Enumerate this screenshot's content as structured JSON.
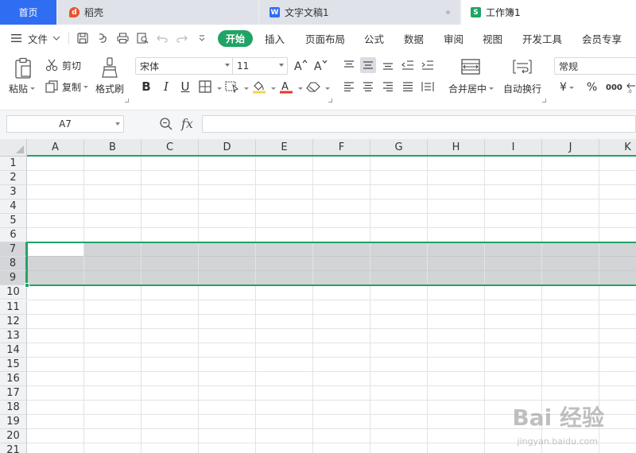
{
  "tabs": [
    {
      "label": "首页"
    },
    {
      "label": "稻壳"
    },
    {
      "label": "文字文稿1"
    },
    {
      "label": "工作簿1"
    }
  ],
  "menu": {
    "file": "文件",
    "start": "开始",
    "items": [
      "插入",
      "页面布局",
      "公式",
      "数据",
      "审阅",
      "视图",
      "开发工具",
      "会员专享"
    ]
  },
  "ribbon": {
    "paste": "粘贴",
    "cut": "剪切",
    "copy": "复制",
    "format_painter": "格式刷",
    "font_name": "宋体",
    "font_size": "11",
    "merge_center": "合并居中",
    "wrap_text": "自动换行",
    "number_format": "常规",
    "currency_symbol": "¥",
    "percent_symbol": "%",
    "thousands_symbol": "000"
  },
  "formula_bar": {
    "name_box": "A7",
    "fx": "fx",
    "content": ""
  },
  "grid": {
    "columns": [
      "A",
      "B",
      "C",
      "D",
      "E",
      "F",
      "G",
      "H",
      "I",
      "J",
      "K"
    ],
    "rows": [
      "1",
      "2",
      "3",
      "4",
      "5",
      "6",
      "7",
      "8",
      "9",
      "10",
      "11",
      "12",
      "13",
      "14",
      "15",
      "16",
      "17",
      "18",
      "19",
      "20",
      "21"
    ],
    "selection": "A7:K9",
    "active_cell": "A7"
  },
  "colors": {
    "accent": "#21a366",
    "home_tab": "#2f6ef2",
    "selection_fill": "#d3d4d6"
  },
  "watermark": {
    "text": "Bai 经验",
    "sub": "jingyan.baidu.com"
  }
}
